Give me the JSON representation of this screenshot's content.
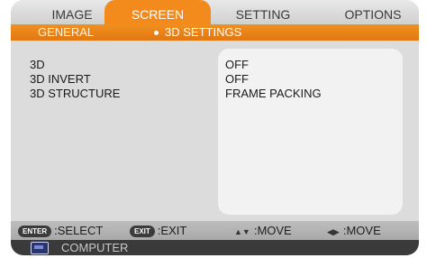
{
  "tabs": [
    {
      "label": "IMAGE"
    },
    {
      "label": "SCREEN"
    },
    {
      "label": "SETTING"
    },
    {
      "label": "OPTIONS"
    }
  ],
  "active_tab": "SCREEN",
  "subtabs": [
    {
      "label": "GENERAL"
    },
    {
      "label": "3D SETTINGS"
    }
  ],
  "active_subtab": "3D SETTINGS",
  "settings": [
    {
      "label": "3D",
      "value": "OFF"
    },
    {
      "label": "3D INVERT",
      "value": "OFF"
    },
    {
      "label": "3D STRUCTURE",
      "value": "FRAME PACKING"
    }
  ],
  "hints": {
    "enter_key": "ENTER",
    "select": ":SELECT",
    "exit_key": "EXIT",
    "exit": ":EXIT",
    "move_vertical_icon": "up-down-arrows",
    "move_vertical": ":MOVE",
    "move_horizontal_icon": "left-right-arrows",
    "move_horizontal": ":MOVE"
  },
  "source": {
    "icon": "monitor-icon",
    "label": "COMPUTER"
  },
  "colors": {
    "accent": "#f28a1c",
    "panel": "#f2f2f2",
    "source_bar": "#3a3a3a"
  }
}
